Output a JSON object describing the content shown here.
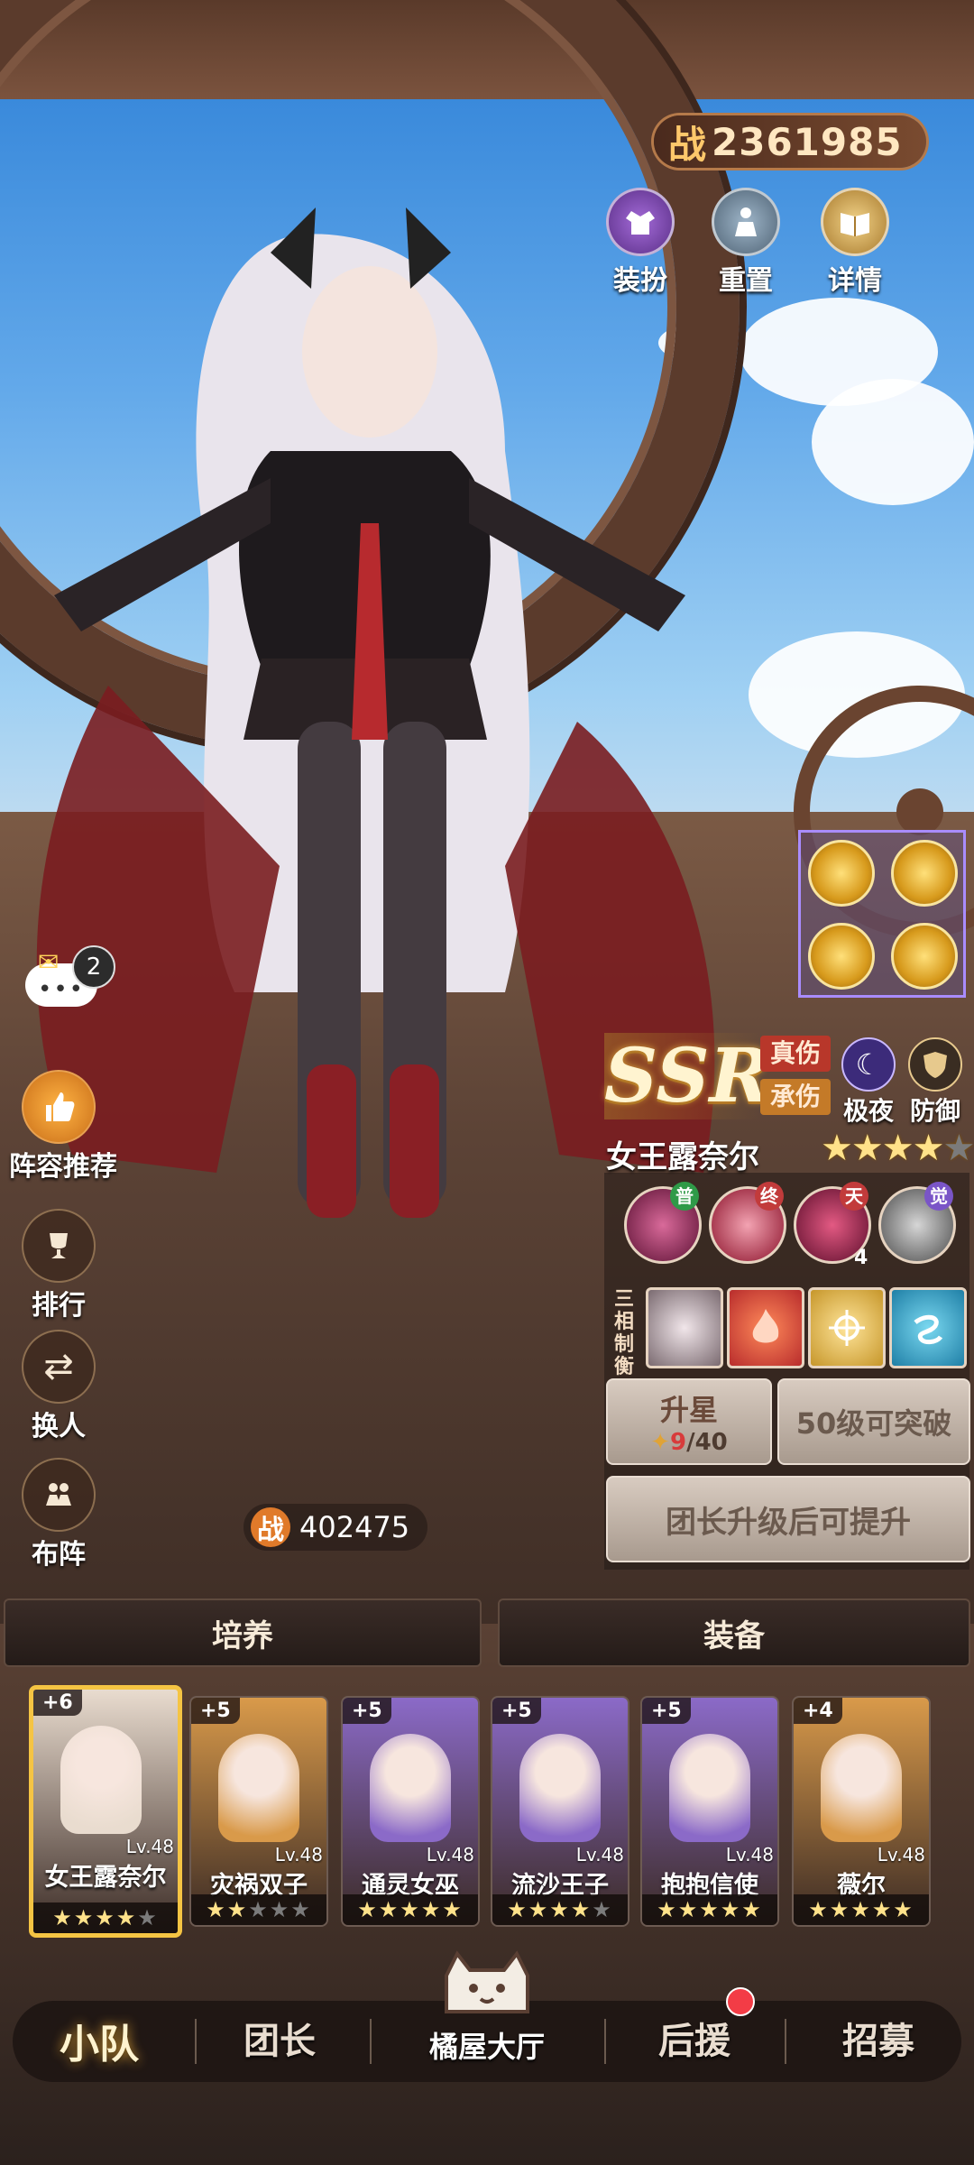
{
  "header": {
    "power_glyph": "战",
    "power_value": "2361985",
    "buttons": [
      {
        "label": "装扮",
        "icon": "outfit-icon"
      },
      {
        "label": "重置",
        "icon": "reset-icon"
      },
      {
        "label": "详情",
        "icon": "details-book-icon"
      }
    ]
  },
  "left_menu": {
    "chat_badge": "2",
    "items": [
      {
        "label": "阵容推荐",
        "icon": "thumbs-up-icon"
      },
      {
        "label": "排行",
        "icon": "trophy-icon"
      },
      {
        "label": "换人",
        "icon": "swap-icon"
      },
      {
        "label": "布阵",
        "icon": "formation-icon"
      }
    ]
  },
  "hero": {
    "rarity": "SSR",
    "tags": [
      "真伤",
      "承伤"
    ],
    "attributes": [
      {
        "label": "极夜",
        "icon": "moon-icon"
      },
      {
        "label": "防御",
        "icon": "shield-icon"
      }
    ],
    "name": "女王露奈尔",
    "stars_filled": 4,
    "stars_total": 5,
    "skills": [
      {
        "tag": "普",
        "icon": "skill-normal-icon"
      },
      {
        "tag": "终",
        "icon": "skill-ultimate-icon"
      },
      {
        "tag": "天",
        "icon": "skill-talent-icon",
        "level": "4"
      },
      {
        "tag": "觉",
        "icon": "skill-awaken-icon"
      }
    ],
    "sanxiang_label": "三相制衡",
    "elements": [
      "fire-element-icon",
      "light-element-icon",
      "wind-element-icon"
    ],
    "star_up_label": "升星",
    "star_up_progress": "9",
    "star_up_total": "/40",
    "breakthrough_label": "50级可突破",
    "upgrade_label": "团长升级后可提升",
    "sub_power_glyph": "战",
    "sub_power_value": "402475"
  },
  "tabs": [
    {
      "label": "培养"
    },
    {
      "label": "装备"
    }
  ],
  "roster": [
    {
      "plus": "+6",
      "level": "Lv.48",
      "name": "女王露奈尔",
      "stars": 4,
      "selected": true,
      "color": "#e9dccf"
    },
    {
      "plus": "+5",
      "level": "Lv.48",
      "name": "灾祸双子",
      "stars": 2,
      "selected": false,
      "color": "#d99a4a"
    },
    {
      "plus": "+5",
      "level": "Lv.48",
      "name": "通灵女巫",
      "stars": 5,
      "selected": false,
      "color": "#8b6ac8"
    },
    {
      "plus": "+5",
      "level": "Lv.48",
      "name": "流沙王子",
      "stars": 4,
      "selected": false,
      "color": "#8b6ac8"
    },
    {
      "plus": "+5",
      "level": "Lv.48",
      "name": "抱抱信使",
      "stars": 5,
      "selected": false,
      "color": "#8b6ac8"
    },
    {
      "plus": "+4",
      "level": "Lv.48",
      "name": "薇尔",
      "stars": 5,
      "selected": false,
      "color": "#d99a4a"
    }
  ],
  "bottom_nav": {
    "items": [
      "小队",
      "团长",
      "后援",
      "招募"
    ],
    "center_label": "橘屋大厅",
    "active": "小队"
  }
}
